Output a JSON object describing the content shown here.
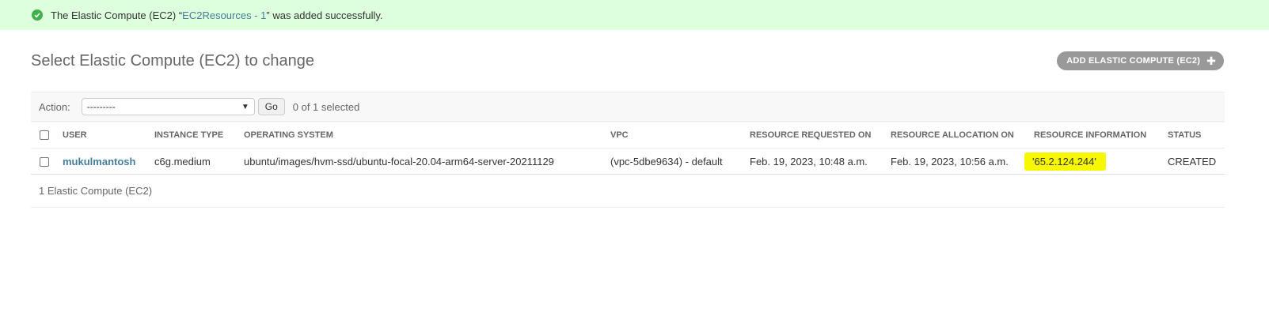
{
  "message": {
    "prefix": "The Elastic Compute (EC2) “",
    "link": "EC2Resources - 1",
    "suffix": "” was added successfully.",
    "icon": "check-circle-icon",
    "color": "#ddffdd"
  },
  "page": {
    "title": "Select Elastic Compute (EC2) to change",
    "add_button": "ADD ELASTIC COMPUTE (EC2)",
    "add_icon": "plus-icon"
  },
  "actions": {
    "label": "Action:",
    "selected_value": "---------",
    "go_label": "Go",
    "counter": "0 of 1 selected"
  },
  "table": {
    "columns": [
      "User",
      "Instance type",
      "Operating system",
      "VPC",
      "Resource requested on",
      "Resource allocation on",
      "Resource information",
      "Status"
    ],
    "rows": [
      {
        "user": "mukulmantosh",
        "instance_type": "c6g.medium",
        "os": "ubuntu/images/hvm-ssd/ubuntu-focal-20.04-arm64-server-20211129",
        "vpc": "(vpc-5dbe9634) - default",
        "requested_on": "Feb. 19, 2023, 10:48 a.m.",
        "allocated_on": "Feb. 19, 2023, 10:56 a.m.",
        "resource_info": "'65.2.124.244'",
        "status": "CREATED"
      }
    ]
  },
  "paginator": "1 Elastic Compute (EC2)",
  "colors": {
    "link": "#447e9b",
    "highlight": "#f7f700",
    "success_bg": "#ddffdd"
  }
}
